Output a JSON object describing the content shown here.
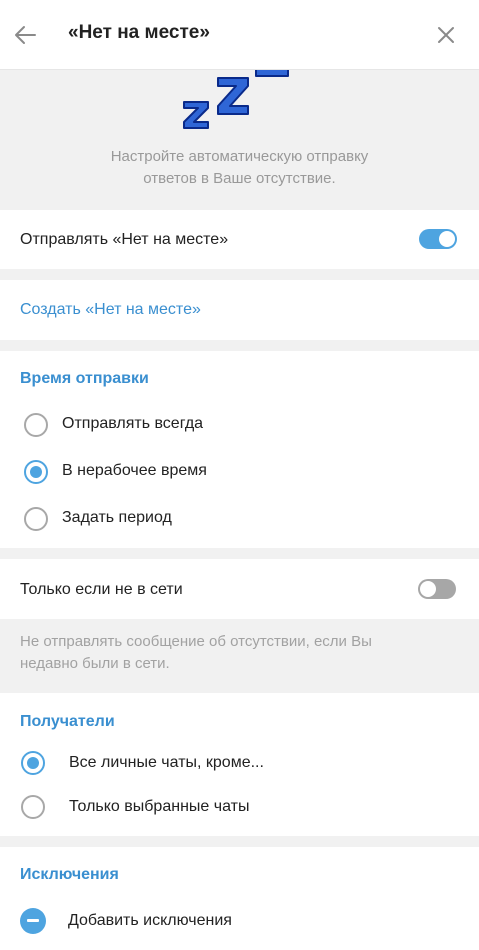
{
  "header": {
    "title": "«Нет на месте»"
  },
  "hero": {
    "text_line1": "Настройте автоматическую отправку",
    "text_line2": "ответов в Ваше отсутствие."
  },
  "send_away": {
    "label": "Отправлять «Нет на месте»",
    "enabled": true
  },
  "create_link": "Создать «Нет на месте»",
  "schedule": {
    "title": "Время отправки",
    "options": [
      {
        "label": "Отправлять всегда",
        "checked": false
      },
      {
        "label": "В нерабочее время",
        "checked": true
      },
      {
        "label": "Задать период",
        "checked": false
      }
    ]
  },
  "offline_only": {
    "label": "Только если не в сети",
    "enabled": false,
    "note_line1": "Не отправлять сообщение об отсутствии, если Вы",
    "note_line2": "недавно были в сети."
  },
  "recipients": {
    "title": "Получатели",
    "options": [
      {
        "label": "Все личные чаты, кроме...",
        "checked": true
      },
      {
        "label": "Только выбранные чаты",
        "checked": false
      }
    ]
  },
  "exceptions": {
    "title": "Исключения",
    "add_label": "Добавить исключения"
  },
  "colors": {
    "accent": "#3a8fd0",
    "toggle_on": "#4ea4e0",
    "background": "#f1f1f1"
  }
}
